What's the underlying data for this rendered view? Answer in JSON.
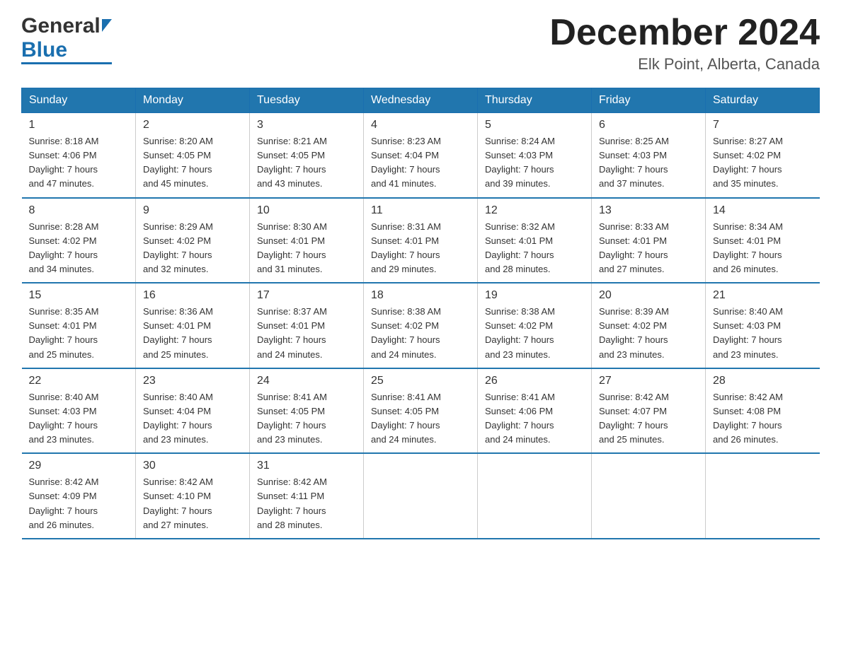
{
  "header": {
    "logo_general": "General",
    "logo_blue": "Blue",
    "month_title": "December 2024",
    "location": "Elk Point, Alberta, Canada"
  },
  "days_of_week": [
    "Sunday",
    "Monday",
    "Tuesday",
    "Wednesday",
    "Thursday",
    "Friday",
    "Saturday"
  ],
  "weeks": [
    [
      {
        "day": "1",
        "sunrise": "8:18 AM",
        "sunset": "4:06 PM",
        "daylight": "7 hours and 47 minutes."
      },
      {
        "day": "2",
        "sunrise": "8:20 AM",
        "sunset": "4:05 PM",
        "daylight": "7 hours and 45 minutes."
      },
      {
        "day": "3",
        "sunrise": "8:21 AM",
        "sunset": "4:05 PM",
        "daylight": "7 hours and 43 minutes."
      },
      {
        "day": "4",
        "sunrise": "8:23 AM",
        "sunset": "4:04 PM",
        "daylight": "7 hours and 41 minutes."
      },
      {
        "day": "5",
        "sunrise": "8:24 AM",
        "sunset": "4:03 PM",
        "daylight": "7 hours and 39 minutes."
      },
      {
        "day": "6",
        "sunrise": "8:25 AM",
        "sunset": "4:03 PM",
        "daylight": "7 hours and 37 minutes."
      },
      {
        "day": "7",
        "sunrise": "8:27 AM",
        "sunset": "4:02 PM",
        "daylight": "7 hours and 35 minutes."
      }
    ],
    [
      {
        "day": "8",
        "sunrise": "8:28 AM",
        "sunset": "4:02 PM",
        "daylight": "7 hours and 34 minutes."
      },
      {
        "day": "9",
        "sunrise": "8:29 AM",
        "sunset": "4:02 PM",
        "daylight": "7 hours and 32 minutes."
      },
      {
        "day": "10",
        "sunrise": "8:30 AM",
        "sunset": "4:01 PM",
        "daylight": "7 hours and 31 minutes."
      },
      {
        "day": "11",
        "sunrise": "8:31 AM",
        "sunset": "4:01 PM",
        "daylight": "7 hours and 29 minutes."
      },
      {
        "day": "12",
        "sunrise": "8:32 AM",
        "sunset": "4:01 PM",
        "daylight": "7 hours and 28 minutes."
      },
      {
        "day": "13",
        "sunrise": "8:33 AM",
        "sunset": "4:01 PM",
        "daylight": "7 hours and 27 minutes."
      },
      {
        "day": "14",
        "sunrise": "8:34 AM",
        "sunset": "4:01 PM",
        "daylight": "7 hours and 26 minutes."
      }
    ],
    [
      {
        "day": "15",
        "sunrise": "8:35 AM",
        "sunset": "4:01 PM",
        "daylight": "7 hours and 25 minutes."
      },
      {
        "day": "16",
        "sunrise": "8:36 AM",
        "sunset": "4:01 PM",
        "daylight": "7 hours and 25 minutes."
      },
      {
        "day": "17",
        "sunrise": "8:37 AM",
        "sunset": "4:01 PM",
        "daylight": "7 hours and 24 minutes."
      },
      {
        "day": "18",
        "sunrise": "8:38 AM",
        "sunset": "4:02 PM",
        "daylight": "7 hours and 24 minutes."
      },
      {
        "day": "19",
        "sunrise": "8:38 AM",
        "sunset": "4:02 PM",
        "daylight": "7 hours and 23 minutes."
      },
      {
        "day": "20",
        "sunrise": "8:39 AM",
        "sunset": "4:02 PM",
        "daylight": "7 hours and 23 minutes."
      },
      {
        "day": "21",
        "sunrise": "8:40 AM",
        "sunset": "4:03 PM",
        "daylight": "7 hours and 23 minutes."
      }
    ],
    [
      {
        "day": "22",
        "sunrise": "8:40 AM",
        "sunset": "4:03 PM",
        "daylight": "7 hours and 23 minutes."
      },
      {
        "day": "23",
        "sunrise": "8:40 AM",
        "sunset": "4:04 PM",
        "daylight": "7 hours and 23 minutes."
      },
      {
        "day": "24",
        "sunrise": "8:41 AM",
        "sunset": "4:05 PM",
        "daylight": "7 hours and 23 minutes."
      },
      {
        "day": "25",
        "sunrise": "8:41 AM",
        "sunset": "4:05 PM",
        "daylight": "7 hours and 24 minutes."
      },
      {
        "day": "26",
        "sunrise": "8:41 AM",
        "sunset": "4:06 PM",
        "daylight": "7 hours and 24 minutes."
      },
      {
        "day": "27",
        "sunrise": "8:42 AM",
        "sunset": "4:07 PM",
        "daylight": "7 hours and 25 minutes."
      },
      {
        "day": "28",
        "sunrise": "8:42 AM",
        "sunset": "4:08 PM",
        "daylight": "7 hours and 26 minutes."
      }
    ],
    [
      {
        "day": "29",
        "sunrise": "8:42 AM",
        "sunset": "4:09 PM",
        "daylight": "7 hours and 26 minutes."
      },
      {
        "day": "30",
        "sunrise": "8:42 AM",
        "sunset": "4:10 PM",
        "daylight": "7 hours and 27 minutes."
      },
      {
        "day": "31",
        "sunrise": "8:42 AM",
        "sunset": "4:11 PM",
        "daylight": "7 hours and 28 minutes."
      },
      null,
      null,
      null,
      null
    ]
  ],
  "labels": {
    "sunrise": "Sunrise:",
    "sunset": "Sunset:",
    "daylight": "Daylight:"
  }
}
